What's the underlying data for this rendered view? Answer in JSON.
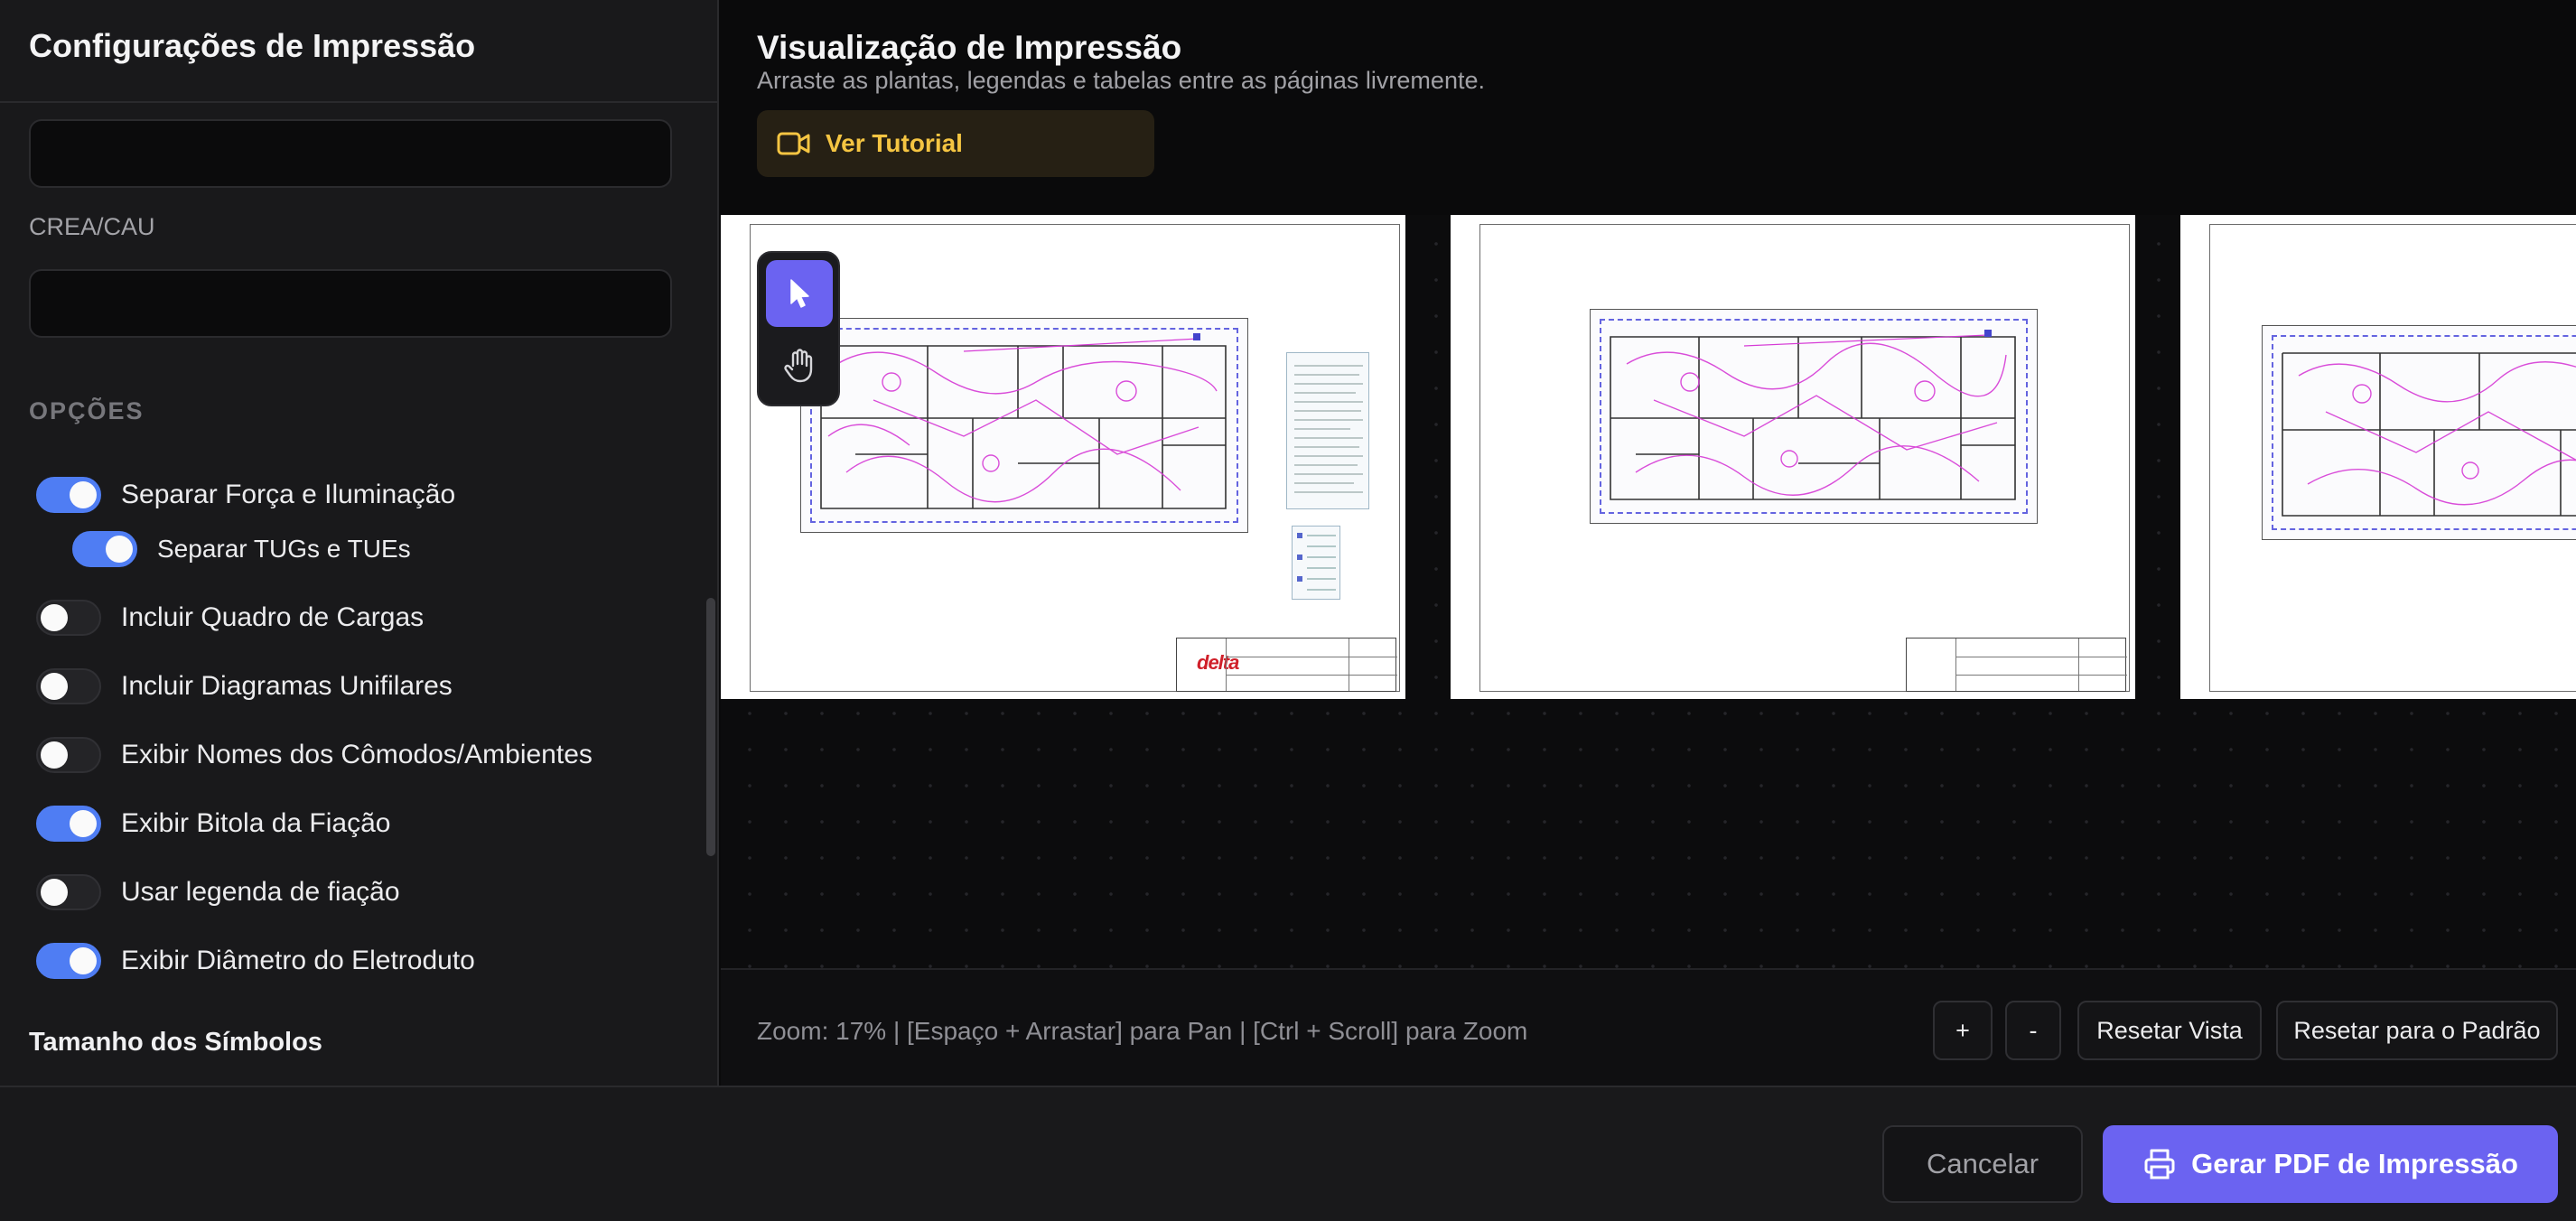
{
  "sidebar": {
    "title": "Configurações de Impressão",
    "fields": {
      "first_value": "",
      "crea_label": "CREA/CAU",
      "crea_value": ""
    },
    "options_section": "OPÇÕES",
    "options": [
      {
        "label": "Separar Força e Iluminação",
        "enabled": true
      },
      {
        "label": "Separar TUGs e TUEs",
        "enabled": true
      },
      {
        "label": "Incluir Quadro de Cargas",
        "enabled": false
      },
      {
        "label": "Incluir Diagramas Unifilares",
        "enabled": false
      },
      {
        "label": "Exibir Nomes dos Cômodos/Ambientes",
        "enabled": false
      },
      {
        "label": "Exibir Bitola da Fiação",
        "enabled": true
      },
      {
        "label": "Usar legenda de fiação",
        "enabled": false
      },
      {
        "label": "Exibir Diâmetro do Eletroduto",
        "enabled": true
      }
    ],
    "symbol_size_title": "Tamanho dos Símbolos"
  },
  "preview": {
    "title": "Visualização de Impressão",
    "subtitle": "Arraste as plantas, legendas e tabelas entre as páginas livremente.",
    "tutorial_label": "Ver Tutorial",
    "sheet_logo": "delta",
    "tools": {
      "select": "cursor-icon",
      "pan": "hand-icon"
    },
    "zoom_info": "Zoom: 17% | [Espaço + Arrastar] para Pan | [Ctrl + Scroll] para Zoom",
    "controls": {
      "zoom_in": "+",
      "zoom_out": "-",
      "reset_view": "Resetar Vista",
      "reset_default": "Resetar para o Padrão"
    }
  },
  "footer": {
    "cancel": "Cancelar",
    "generate": "Gerar PDF de Impressão"
  },
  "colors": {
    "accent": "#6b63f1",
    "toggle_on": "#4f7df3",
    "tutorial_text": "#f5c542"
  }
}
